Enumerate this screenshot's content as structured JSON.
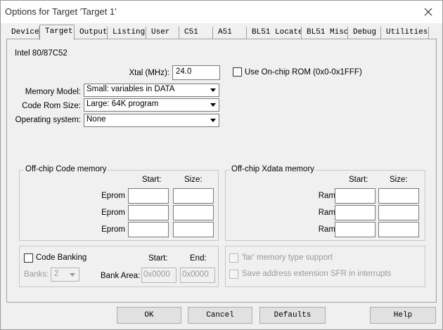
{
  "window": {
    "title": "Options for Target 'Target 1'"
  },
  "tabs": [
    {
      "label": "Device"
    },
    {
      "label": "Target"
    },
    {
      "label": "Output"
    },
    {
      "label": "Listing"
    },
    {
      "label": "User"
    },
    {
      "label": "C51"
    },
    {
      "label": "A51"
    },
    {
      "label": "BL51 Locate"
    },
    {
      "label": "BL51 Misc"
    },
    {
      "label": "Debug"
    },
    {
      "label": "Utilities"
    }
  ],
  "active_tab": "Target",
  "target": {
    "device_name": "Intel 80/87C52",
    "xtal_label": "Xtal (MHz):",
    "xtal_value": "24.0",
    "use_onchip_rom_label": "Use On-chip ROM (0x0-0x1FFF)",
    "memory_model_label": "Memory Model:",
    "memory_model_value": "Small: variables in DATA",
    "code_rom_label": "Code Rom Size:",
    "code_rom_value": "Large: 64K program",
    "os_label": "Operating system:",
    "os_value": "None"
  },
  "code_memory": {
    "title": "Off-chip Code memory",
    "start_header": "Start:",
    "size_header": "Size:",
    "rows": [
      {
        "label": "Eprom"
      },
      {
        "label": "Eprom"
      },
      {
        "label": "Eprom"
      }
    ]
  },
  "xdata_memory": {
    "title": "Off-chip Xdata memory",
    "start_header": "Start:",
    "size_header": "Size:",
    "rows": [
      {
        "label": "Ram"
      },
      {
        "label": "Ram"
      },
      {
        "label": "Ram"
      }
    ]
  },
  "banking": {
    "code_banking_label": "Code Banking",
    "start_header": "Start:",
    "end_header": "End:",
    "banks_label": "Banks:",
    "banks_value": "2",
    "bank_area_label": "Bank Area:",
    "bank_area_start": "0x0000",
    "bank_area_end": "0x0000"
  },
  "far_options": {
    "far_memory_label": "'far' memory type support",
    "save_sfr_label": "Save address extension SFR in interrupts"
  },
  "buttons": {
    "ok": "OK",
    "cancel": "Cancel",
    "defaults": "Defaults",
    "help": "Help"
  }
}
